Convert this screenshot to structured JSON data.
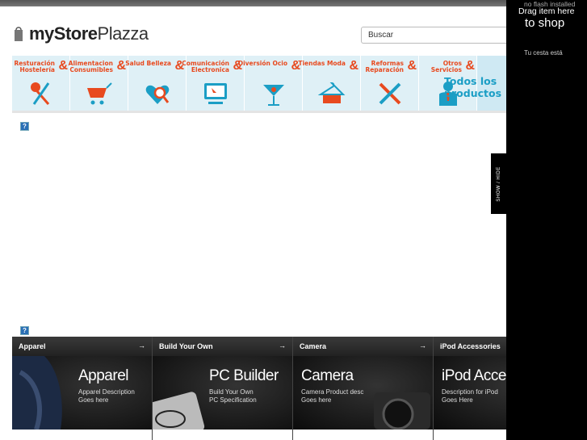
{
  "header": {
    "logo_bold": "myStore",
    "logo_light": "Plazza",
    "search_value": "Buscar"
  },
  "nav": {
    "items": [
      {
        "label": "Resturación Hostelería",
        "icon": "fork-knife-icon"
      },
      {
        "label": "Alimentacion Consumibles",
        "icon": "shopping-cart-icon"
      },
      {
        "label": "Salud Belleza",
        "icon": "heart-magnifier-icon"
      },
      {
        "label": "Comunicación Electronica",
        "icon": "monitor-icon"
      },
      {
        "label": "Diversión Ocio",
        "icon": "cocktail-icon"
      },
      {
        "label": "Tiendas Moda",
        "icon": "hanger-icon"
      },
      {
        "label": "Reformas Reparación",
        "icon": "tools-icon"
      },
      {
        "label": "Otros Servicios",
        "icon": "person-icon"
      }
    ],
    "amp": "&",
    "all_label": "Todos los productos"
  },
  "help_mark": "?",
  "categories": [
    {
      "head": "Apparel",
      "arrow": "→",
      "title": "Apparel",
      "desc1": "Apparel Description",
      "desc2": "Goes here"
    },
    {
      "head": "Build Your Own",
      "arrow": "→",
      "title": "PC Builder",
      "desc1": "Build Your Own",
      "desc2": "PC Specification"
    },
    {
      "head": "Camera",
      "arrow": "→",
      "title": "Camera",
      "desc1": "Camera Product desc",
      "desc2": "Goes here"
    },
    {
      "head": "iPod Accessories",
      "arrow": "",
      "title": "iPod Acces",
      "desc1": "Description for iPod",
      "desc2": "Goes Here"
    }
  ],
  "sidebar": {
    "no_flash": "no flash installed",
    "drag_line1": "Drag item here",
    "drag_line2": "to shop",
    "cesta": "Tu cesta está",
    "show_hide": "SHOW / HIDE"
  },
  "colors": {
    "accent_orange": "#e84a1f",
    "accent_blue": "#1b9ec5",
    "nav_bg": "#dff0f6"
  }
}
